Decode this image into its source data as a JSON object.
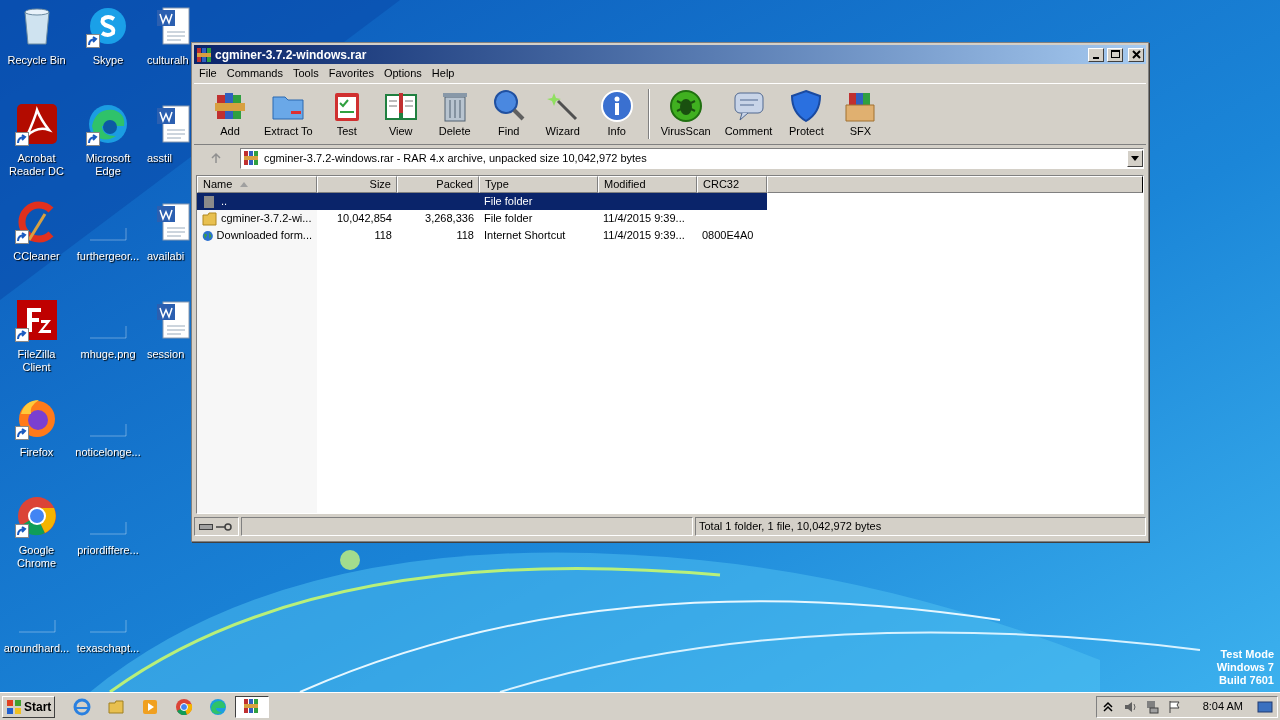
{
  "desktop": {
    "columns": [
      [
        {
          "label": "Recycle Bin",
          "kind": "recycle",
          "shortcut": false
        },
        {
          "label": "Acrobat Reader DC",
          "kind": "acrobat",
          "shortcut": true
        },
        {
          "label": "CCleaner",
          "kind": "ccleaner",
          "shortcut": true
        },
        {
          "label": "FileZilla Client",
          "kind": "filezilla",
          "shortcut": true
        },
        {
          "label": "Firefox",
          "kind": "firefox",
          "shortcut": true
        },
        {
          "label": "Google Chrome",
          "kind": "chrome",
          "shortcut": true
        },
        {
          "label": "aroundhard...",
          "kind": "blank",
          "shortcut": false
        }
      ],
      [
        {
          "label": "Skype",
          "kind": "skype",
          "shortcut": true
        },
        {
          "label": "Microsoft Edge",
          "kind": "edge",
          "shortcut": true
        },
        {
          "label": "furthergeor...",
          "kind": "blank",
          "shortcut": false
        },
        {
          "label": "mhuge.png",
          "kind": "blank",
          "shortcut": false
        },
        {
          "label": "noticelonge...",
          "kind": "blank",
          "shortcut": false
        },
        {
          "label": "priordiffere...",
          "kind": "blank",
          "shortcut": false
        },
        {
          "label": "texaschapt...",
          "kind": "blank",
          "shortcut": false
        }
      ],
      [
        {
          "label": "culturalh",
          "kind": "word",
          "shortcut": false
        },
        {
          "label": "asstil",
          "kind": "word",
          "shortcut": false
        },
        {
          "label": "availabi",
          "kind": "word",
          "shortcut": false
        },
        {
          "label": "session",
          "kind": "word",
          "shortcut": false
        }
      ]
    ]
  },
  "window": {
    "title": "cgminer-3.7.2-windows.rar",
    "menu": [
      "File",
      "Commands",
      "Tools",
      "Favorites",
      "Options",
      "Help"
    ],
    "toolbar": [
      [
        {
          "label": "Add",
          "kind": "add"
        },
        {
          "label": "Extract To",
          "kind": "extract"
        },
        {
          "label": "Test",
          "kind": "test"
        },
        {
          "label": "View",
          "kind": "view"
        },
        {
          "label": "Delete",
          "kind": "delete"
        },
        {
          "label": "Find",
          "kind": "find"
        },
        {
          "label": "Wizard",
          "kind": "wizard"
        },
        {
          "label": "Info",
          "kind": "info"
        }
      ],
      [
        {
          "label": "VirusScan",
          "kind": "virus"
        },
        {
          "label": "Comment",
          "kind": "comment"
        },
        {
          "label": "Protect",
          "kind": "protect"
        },
        {
          "label": "SFX",
          "kind": "sfx"
        }
      ]
    ],
    "address": "cgminer-3.7.2-windows.rar - RAR 4.x archive, unpacked size 10,042,972 bytes",
    "table": {
      "columns": [
        {
          "label": "Name",
          "sorted": true
        },
        {
          "label": "Size",
          "sorted": false
        },
        {
          "label": "Packed",
          "sorted": false
        },
        {
          "label": "Type",
          "sorted": false
        },
        {
          "label": "Modified",
          "sorted": false
        },
        {
          "label": "CRC32",
          "sorted": false
        }
      ],
      "rows": [
        {
          "kind": "up",
          "selected": true,
          "cells": [
            "..",
            "",
            "",
            "File folder",
            "",
            ""
          ]
        },
        {
          "kind": "folder",
          "selected": false,
          "cells": [
            "cgminer-3.7.2-wi...",
            "10,042,854",
            "3,268,336",
            "File folder",
            "11/4/2015 9:39...",
            ""
          ]
        },
        {
          "kind": "internet",
          "selected": false,
          "cells": [
            "Downloaded form...",
            "118",
            "118",
            "Internet Shortcut",
            "11/4/2015 9:39...",
            "0800E4A0"
          ]
        }
      ]
    },
    "status_bar": "Total 1 folder, 1 file, 10,042,972 bytes"
  },
  "taskbar": {
    "start": "Start",
    "apps": [
      {
        "kind": "ie",
        "selected": false
      },
      {
        "kind": "explorer",
        "selected": false
      },
      {
        "kind": "media",
        "selected": false
      },
      {
        "kind": "chrome",
        "selected": false
      },
      {
        "kind": "edge",
        "selected": false
      },
      {
        "kind": "winrar",
        "selected": true
      }
    ],
    "time": "8:04 AM"
  },
  "watermark_os": [
    "Test Mode",
    "Windows 7",
    "Build 7601"
  ]
}
